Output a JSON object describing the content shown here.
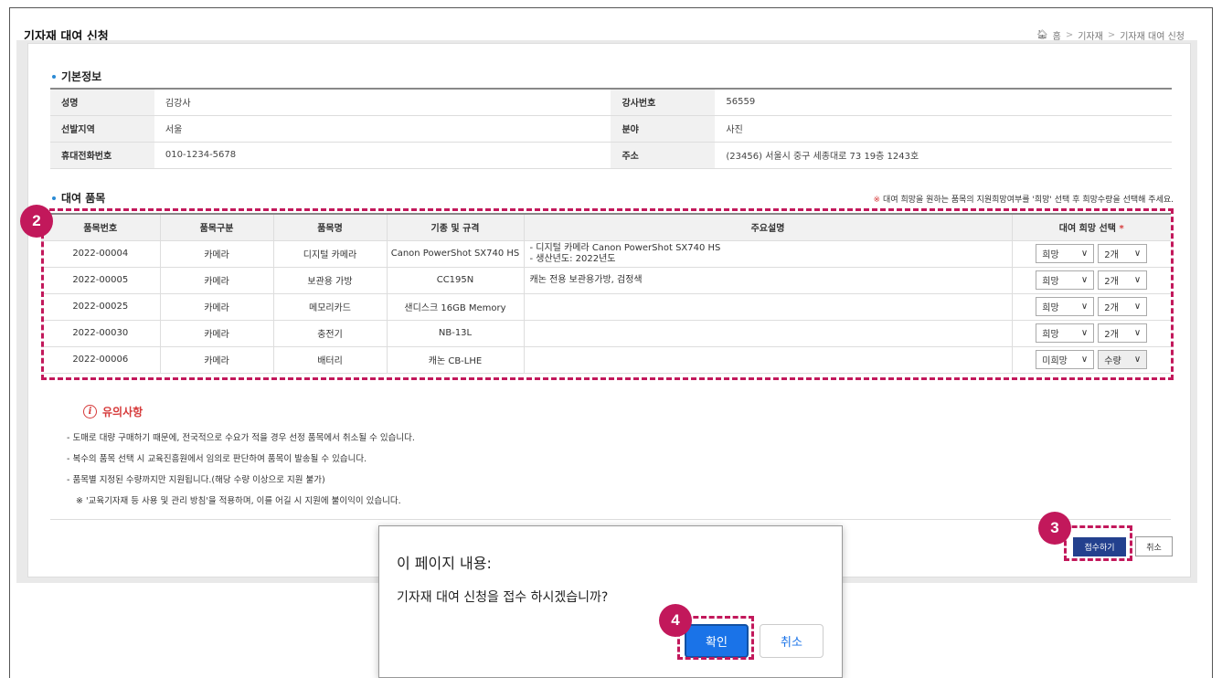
{
  "page": {
    "title": "기자재 대여 신청",
    "breadcrumb": [
      "홈",
      "기자재",
      "기자재 대여 신청"
    ]
  },
  "basic_info": {
    "section_title": "기본정보",
    "rows": [
      {
        "label1": "성명",
        "value1": "김강사",
        "label2": "강사번호",
        "value2": "56559"
      },
      {
        "label1": "선발지역",
        "value1": "서울",
        "label2": "분야",
        "value2": "사진"
      },
      {
        "label1": "휴대전화번호",
        "value1": "010-1234-5678",
        "label2": "주소",
        "value2": "(23456) 서울시 중구 세종대로 73 19층 1243호"
      }
    ]
  },
  "rental": {
    "section_title": "대여 품목",
    "notice_mark": "※",
    "notice": "대여 희망을 원하는 품목의 지원희망여부를 '희망' 선택 후 희망수량을 선택해 주세요.",
    "headers": [
      "품목번호",
      "품목구분",
      "품목명",
      "기종 및 규격",
      "주요설명",
      "대여 희망 선택"
    ],
    "required_mark": "*",
    "rows": [
      {
        "no": "2022-00004",
        "category": "카메라",
        "name": "디지털 카메라",
        "model": "Canon PowerShot SX740 HS",
        "desc1": "- 디지털 카메라 Canon PowerShot SX740 HS",
        "desc2": "- 생산년도: 2022년도",
        "hope": "희망",
        "qty": "2개"
      },
      {
        "no": "2022-00005",
        "category": "카메라",
        "name": "보관용 가방",
        "model": "CC195N",
        "desc1": "캐논 전용 보관용가방, 검정색",
        "desc2": "",
        "hope": "희망",
        "qty": "2개"
      },
      {
        "no": "2022-00025",
        "category": "카메라",
        "name": "메모리카드",
        "model": "샌디스크 16GB Memory",
        "desc1": "",
        "desc2": "",
        "hope": "희망",
        "qty": "2개"
      },
      {
        "no": "2022-00030",
        "category": "카메라",
        "name": "충전기",
        "model": "NB-13L",
        "desc1": "",
        "desc2": "",
        "hope": "희망",
        "qty": "2개"
      },
      {
        "no": "2022-00006",
        "category": "카메라",
        "name": "배터리",
        "model": "캐논 CB-LHE",
        "desc1": "",
        "desc2": "",
        "hope": "미희망",
        "qty": "수량"
      }
    ]
  },
  "caution": {
    "title": "유의사항",
    "items": [
      "- 도매로 대량 구매하기 때문에, 전국적으로 수요가 적을 경우 선정 품목에서 취소될 수 있습니다.",
      "- 복수의 품목 선택 시 교육진흥원에서 임의로 판단하여 품목이 발송될 수 있습니다.",
      "- 품목별 지정된 수량까지만 지원됩니다.(해당 수량 이상으로 지원 불가)"
    ],
    "sub": "※ '교육기자재 등 사용 및 관리 방침'을 적용하며, 이를 어길 시 지원에 불이익이 있습니다."
  },
  "actions": {
    "submit": "접수하기",
    "cancel": "취소"
  },
  "dialog": {
    "title": "이 페이지 내용:",
    "message": "기자재 대여 신청을 접수 하시겠습니까?",
    "ok": "확인",
    "cancel": "취소"
  },
  "callouts": {
    "b2": "2",
    "b3": "3",
    "b4": "4"
  },
  "colors": {
    "accent": "#c2185b",
    "primary": "#23408e",
    "dialog_primary": "#1a73e8",
    "notice_red": "#d63b3b"
  }
}
